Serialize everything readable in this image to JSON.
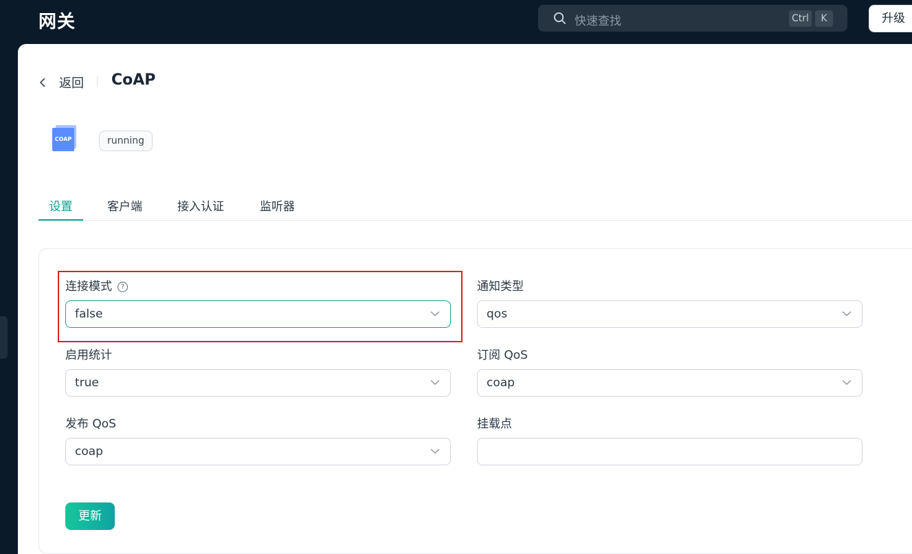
{
  "header": {
    "title": "网关",
    "search_placeholder": "快速查找",
    "shortcut_keys": [
      "Ctrl",
      "K"
    ],
    "upgrade_label": "升级"
  },
  "page": {
    "back_label": "返回",
    "title": "CoAP",
    "logo_text": "COAP",
    "status": "running"
  },
  "tabs": [
    {
      "label": "设置",
      "active": true
    },
    {
      "label": "客户端",
      "active": false
    },
    {
      "label": "接入认证",
      "active": false
    },
    {
      "label": "监听器",
      "active": false
    }
  ],
  "form": {
    "connection_mode": {
      "label": "连接模式",
      "help": "?",
      "value": "false"
    },
    "notify_type": {
      "label": "通知类型",
      "value": "qos"
    },
    "enable_stats": {
      "label": "启用统计",
      "value": "true"
    },
    "subscribe_qos": {
      "label": "订阅 QoS",
      "value": "coap"
    },
    "publish_qos": {
      "label": "发布 QoS",
      "value": "coap"
    },
    "mountpoint": {
      "label": "挂载点",
      "value": ""
    },
    "submit_label": "更新"
  },
  "colors": {
    "accent": "#0aa08d",
    "highlight_border": "#d9242b",
    "background": "#0b1a29"
  }
}
